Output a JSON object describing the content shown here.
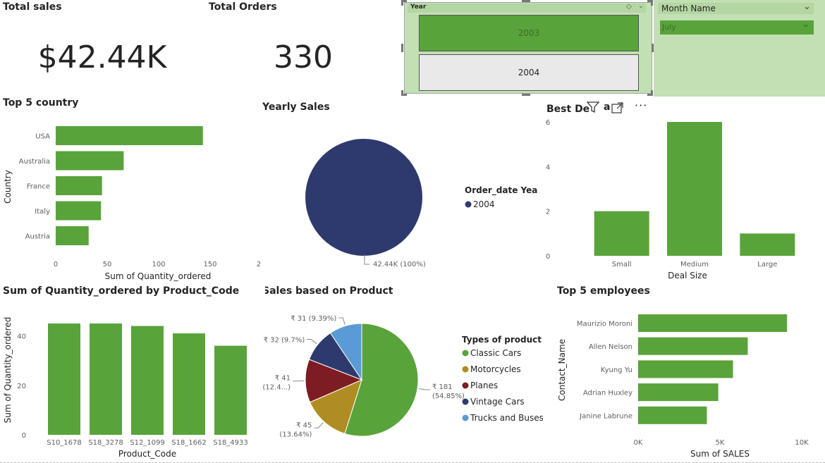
{
  "kpis": {
    "total_sales_title": "Total sales",
    "total_sales_value": "$42.44K",
    "total_orders_title": "Total Orders",
    "total_orders_value": "330"
  },
  "slicers": {
    "year": {
      "title": "Year",
      "options": [
        "2003",
        "2004"
      ],
      "selected_color": "#59a33b",
      "unselected_color": "#e9e9e9"
    },
    "month": {
      "title": "Month Name",
      "selected": "July"
    }
  },
  "chart_data": [
    {
      "id": "top5country",
      "type": "bar",
      "orientation": "horizontal",
      "title": "Top 5 country",
      "categories": [
        "USA",
        "Australia",
        "France",
        "Italy",
        "Austria"
      ],
      "values": [
        143,
        66,
        45,
        44,
        32
      ],
      "xlabel": "Sum of Quantity_ordered",
      "ylabel": "Country",
      "xticks": [
        "0",
        "50",
        "100",
        "150",
        "2"
      ],
      "xlim": [
        0,
        200
      ],
      "color": "#59a33b"
    },
    {
      "id": "yearly",
      "type": "pie",
      "title": "Yearly Sales",
      "legend_title": "Order_date Year",
      "labels": [
        "2004"
      ],
      "values": [
        100
      ],
      "data_labels": [
        "42.44K (100%)"
      ],
      "colors": [
        "#2e3a6e"
      ]
    },
    {
      "id": "dealsize",
      "type": "bar",
      "title": "Best De",
      "title_tail": "a",
      "categories": [
        "Small",
        "Medium",
        "Large"
      ],
      "values": [
        2,
        6,
        1
      ],
      "xlabel": "Deal Size",
      "yticks": [
        "0",
        "2",
        "4",
        "6"
      ],
      "ylim": [
        0,
        6
      ],
      "color": "#59a33b"
    },
    {
      "id": "productcode",
      "type": "bar",
      "title": "Sum of Quantity_ordered by Product_Code",
      "categories": [
        "S10_1678",
        "S18_3278",
        "S12_1099",
        "S18_1662",
        "S18_4933"
      ],
      "values": [
        45,
        45,
        44,
        41,
        36
      ],
      "xlabel": "Product_Code",
      "ylabel": "Sum of Quantity_ordered",
      "yticks": [
        "0",
        "20",
        "40"
      ],
      "ylim": [
        0,
        49
      ],
      "color": "#59a33b"
    },
    {
      "id": "product",
      "type": "pie",
      "title": "Sales based on Product",
      "legend_title": "Types of product",
      "labels": [
        "Classic Cars",
        "Motorcycles",
        "Planes",
        "Vintage Cars",
        "Trucks and Buses"
      ],
      "values": [
        54.85,
        13.64,
        12.4,
        9.7,
        9.39
      ],
      "colors": [
        "#59a33b",
        "#b08d22",
        "#7d1c22",
        "#2e3a6e",
        "#5b9bd5"
      ],
      "data_labels": [
        [
          "₹ 181",
          "(54.85%)"
        ],
        [
          "₹ 45",
          "(13.64%)"
        ],
        [
          "₹ 41",
          "(12.4...)"
        ],
        [
          "₹ 32 (9.7%)"
        ],
        [
          "₹ 31 (9.39%)"
        ]
      ]
    },
    {
      "id": "employees",
      "type": "bar",
      "orientation": "horizontal",
      "title": "Top 5 employees",
      "categories": [
        "Maurizio Moroni",
        "Allen Nelson",
        "Kyung Yu",
        "Adrian Huxley",
        "Janine Labrune"
      ],
      "values": [
        9100,
        6700,
        5800,
        4900,
        4200
      ],
      "xlabel": "Sum of SALES",
      "ylabel": "Contact_Name",
      "xticks": [
        "0K",
        "5K",
        "10K"
      ],
      "xlim": [
        0,
        10000
      ],
      "color": "#59a33b"
    }
  ]
}
